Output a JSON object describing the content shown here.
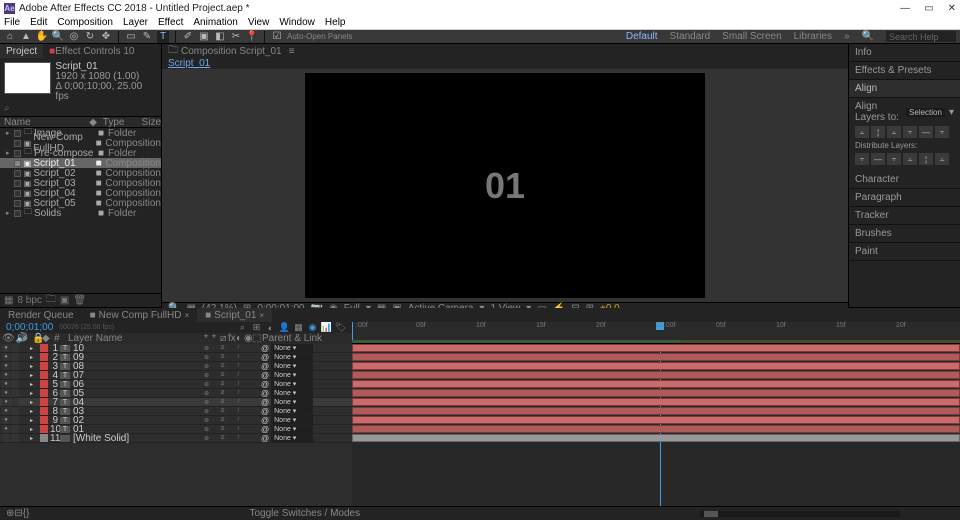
{
  "app": {
    "title": "Adobe After Effects CC 2018 - Untitled Project.aep *"
  },
  "menu": [
    "File",
    "Edit",
    "Composition",
    "Layer",
    "Effect",
    "Animation",
    "View",
    "Window",
    "Help"
  ],
  "toolbar": {
    "auto_open": "Auto-Open Panels",
    "workspaces": [
      "Default",
      "Standard",
      "Small Screen",
      "Libraries"
    ],
    "search_placeholder": "Search Help"
  },
  "project": {
    "tab_project": "Project",
    "tab_ec": "Effect Controls 10",
    "sel_name": "Script_01",
    "sel_res": "1920 x 1080 (1.00)",
    "sel_dur": "Δ 0;00;10;00, 25.00 fps",
    "cols": {
      "name": "Name",
      "type": "Type",
      "size": "Size"
    },
    "items": [
      {
        "name": "Image",
        "type": "Folder",
        "folder": true
      },
      {
        "name": "New Comp FullHD",
        "type": "Composition"
      },
      {
        "name": "Pre-compose",
        "type": "Folder",
        "folder": true
      },
      {
        "name": "Script_01",
        "type": "Composition",
        "sel": true
      },
      {
        "name": "Script_02",
        "type": "Composition"
      },
      {
        "name": "Script_03",
        "type": "Composition"
      },
      {
        "name": "Script_04",
        "type": "Composition"
      },
      {
        "name": "Script_05",
        "type": "Composition"
      },
      {
        "name": "Solids",
        "type": "Folder",
        "folder": true
      }
    ],
    "footer_bpc": "8 bpc"
  },
  "comp": {
    "panel_label": "Composition Script_01",
    "crumb": "Script_01",
    "display": "01",
    "ctrl": {
      "zoom": "(42.1%)",
      "time": "0;00;01;00",
      "res": "Full",
      "cam": "Active Camera",
      "view": "1 View",
      "aspect": "+0.0"
    }
  },
  "right": {
    "info": "Info",
    "ep": "Effects & Presets",
    "align": "Align",
    "align_to_lbl": "Align Layers to:",
    "align_to": "Selection",
    "distribute": "Distribute Layers:",
    "sections": [
      "Character",
      "Paragraph",
      "Tracker",
      "Brushes",
      "Paint"
    ]
  },
  "timeline": {
    "tabs": [
      {
        "label": "Render Queue"
      },
      {
        "label": "New Comp FullHD"
      },
      {
        "label": "Script_01",
        "active": true
      }
    ],
    "timecode": "0;00;01;00",
    "timecode2": "00026 (25.00 fps)",
    "col_idx": "#",
    "col_layer": "Layer Name",
    "col_parent": "Parent & Link",
    "ruler": [
      ":00f",
      "05f",
      "10f",
      "15f",
      "20f",
      "01:00f",
      "05f",
      "10f",
      "15f",
      "20f"
    ],
    "layers": [
      {
        "idx": 1,
        "name": "10",
        "none": "None",
        "color": "#c44"
      },
      {
        "idx": 2,
        "name": "09",
        "none": "None",
        "color": "#c44"
      },
      {
        "idx": 3,
        "name": "08",
        "none": "None",
        "color": "#c44"
      },
      {
        "idx": 4,
        "name": "07",
        "none": "None",
        "color": "#c44"
      },
      {
        "idx": 5,
        "name": "06",
        "none": "None",
        "color": "#c44"
      },
      {
        "idx": 6,
        "name": "05",
        "none": "None",
        "color": "#c44"
      },
      {
        "idx": 7,
        "name": "04",
        "none": "None",
        "color": "#c44",
        "hl": true
      },
      {
        "idx": 8,
        "name": "03",
        "none": "None",
        "color": "#c44"
      },
      {
        "idx": 9,
        "name": "02",
        "none": "None",
        "color": "#c44"
      },
      {
        "idx": 10,
        "name": "01",
        "none": "None",
        "color": "#c44"
      },
      {
        "idx": 11,
        "name": "[White Solid]",
        "none": "None",
        "color": "#888",
        "solid": true
      }
    ],
    "toggle": "Toggle Switches / Modes"
  }
}
